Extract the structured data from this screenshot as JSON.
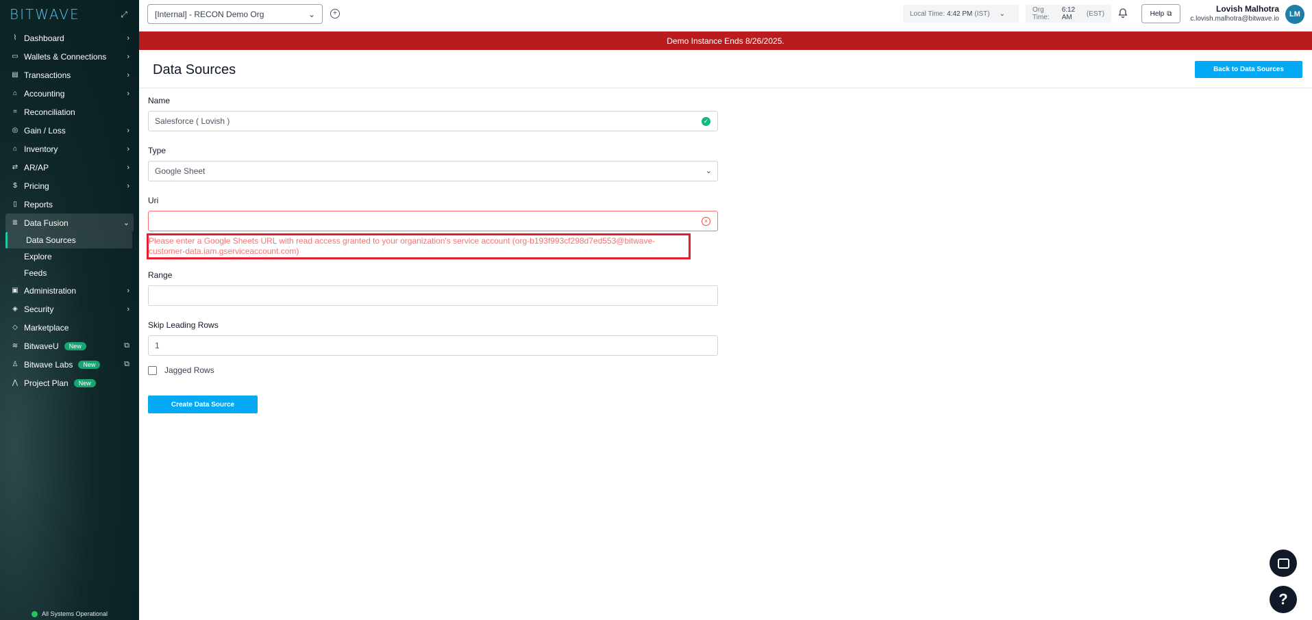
{
  "app": {
    "logo": "BITWAVE"
  },
  "sidebar": {
    "items": [
      {
        "label": "Dashboard",
        "icon": "chart-line-icon",
        "glyph": "⌇",
        "chevron": true
      },
      {
        "label": "Wallets & Connections",
        "icon": "wallet-icon",
        "glyph": "▭",
        "chevron": true
      },
      {
        "label": "Transactions",
        "icon": "table-icon",
        "glyph": "▤",
        "chevron": true
      },
      {
        "label": "Accounting",
        "icon": "bank-icon",
        "glyph": "⌂",
        "chevron": true
      },
      {
        "label": "Reconciliation",
        "icon": "equals-icon",
        "glyph": "=",
        "chevron": false
      },
      {
        "label": "Gain / Loss",
        "icon": "coins-icon",
        "glyph": "◎",
        "chevron": true
      },
      {
        "label": "Inventory",
        "icon": "warehouse-icon",
        "glyph": "⌂",
        "chevron": true
      },
      {
        "label": "AR/AP",
        "icon": "invoice-icon",
        "glyph": "⇄",
        "chevron": true
      },
      {
        "label": "Pricing",
        "icon": "dollar-icon",
        "glyph": "$",
        "chevron": true
      },
      {
        "label": "Reports",
        "icon": "document-icon",
        "glyph": "▯",
        "chevron": false
      },
      {
        "label": "Data Fusion",
        "icon": "database-icon",
        "glyph": "≣",
        "chevron": true
      }
    ],
    "sub_items": [
      "Data Sources",
      "Explore",
      "Feeds"
    ],
    "items_after": [
      {
        "label": "Administration",
        "icon": "admin-icon",
        "glyph": "▣",
        "chevron": true
      },
      {
        "label": "Security",
        "icon": "shield-icon",
        "glyph": "◈",
        "chevron": true
      },
      {
        "label": "Marketplace",
        "icon": "tag-icon",
        "glyph": "◇",
        "chevron": false
      }
    ],
    "new_items": [
      {
        "label": "BitwaveU",
        "icon": "graduation-cap-icon",
        "glyph": "≋",
        "badge": "New",
        "external": true
      },
      {
        "label": "Bitwave Labs",
        "icon": "flask-icon",
        "glyph": "♙",
        "badge": "New",
        "external": true
      },
      {
        "label": "Project Plan",
        "icon": "road-icon",
        "glyph": "⋀",
        "badge": "New",
        "external": false
      }
    ],
    "status": "All Systems Operational"
  },
  "header": {
    "org": "[Internal] - RECON Demo Org",
    "local_time_label": "Local Time:",
    "local_time_value": "4:42 PM",
    "local_tz": "(IST)",
    "org_time_label": "Org Time:",
    "org_time_value": "6:12 AM",
    "org_tz": "(EST)",
    "help": "Help",
    "user_name": "Lovish Malhotra",
    "user_email": "c.lovish.malhotra@bitwave.io",
    "avatar": "LM"
  },
  "banner": "Demo Instance Ends 8/26/2025.",
  "page": {
    "title": "Data Sources",
    "back_button": "Back to Data Sources"
  },
  "form": {
    "name_label": "Name",
    "name_value": "Salesforce ( Lovish )",
    "type_label": "Type",
    "type_value": "Google Sheet",
    "uri_label": "Uri",
    "uri_value": "",
    "uri_error": "Please enter a Google Sheets URL with read access granted to your organization's service account (org-b193f993cf298d7ed553@bitwave-customer-data.iam.gserviceaccount.com)",
    "range_label": "Range",
    "range_value": "",
    "skip_label": "Skip Leading Rows",
    "skip_value": "1",
    "jagged_label": "Jagged Rows",
    "submit": "Create Data Source"
  }
}
